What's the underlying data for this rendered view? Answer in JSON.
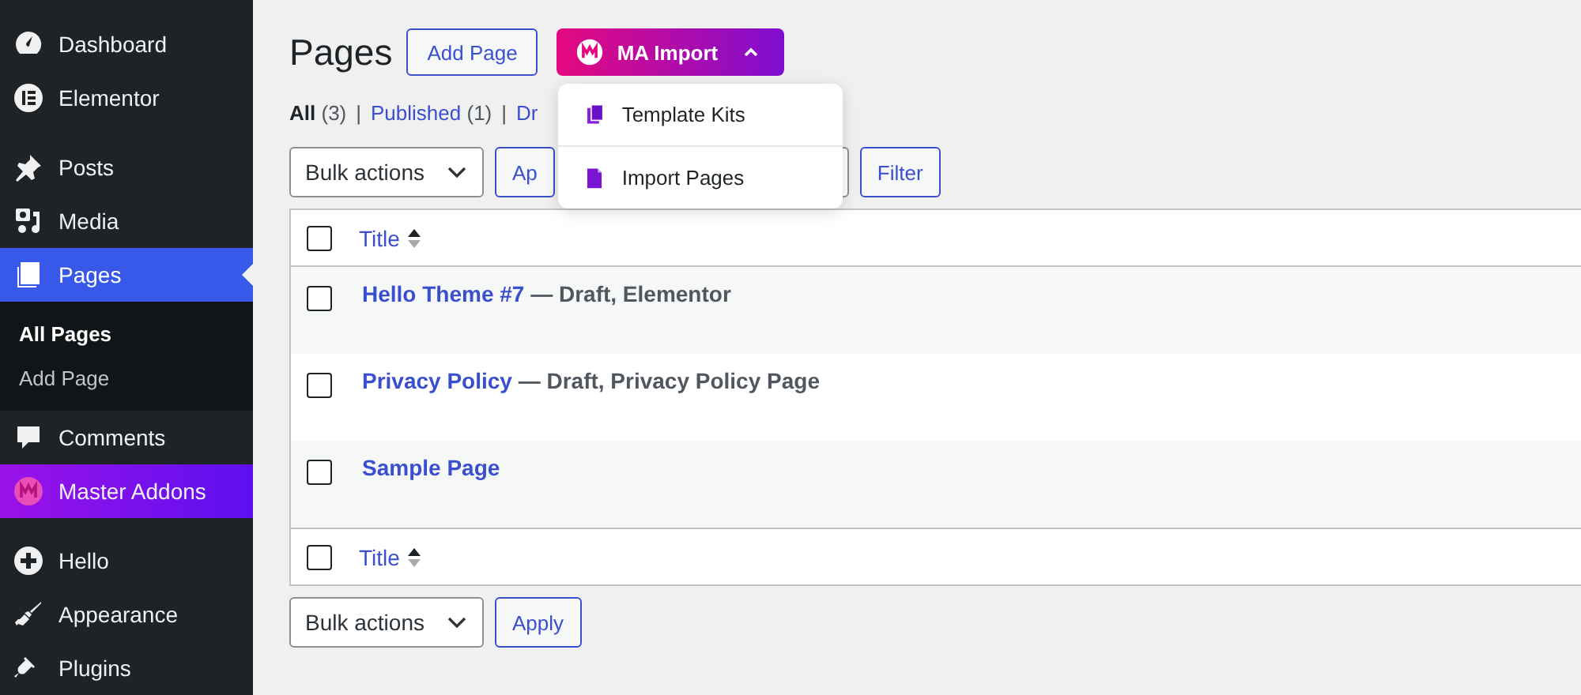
{
  "sidebar": {
    "groups": [
      [
        {
          "label": "Dashboard",
          "kind": "item",
          "selected": false
        },
        {
          "label": "Elementor",
          "kind": "item",
          "selected": false
        }
      ],
      [
        {
          "label": "Posts",
          "kind": "item",
          "selected": false
        },
        {
          "label": "Media",
          "kind": "item",
          "selected": false
        },
        {
          "label": "Pages",
          "kind": "item",
          "selected": true,
          "children": [
            {
              "label": "All Pages",
              "selected": true
            },
            {
              "label": "Add Page",
              "selected": false
            }
          ]
        },
        {
          "label": "Comments",
          "kind": "item",
          "selected": false
        },
        {
          "label": "Master Addons",
          "kind": "plugin",
          "selected": false
        }
      ],
      [
        {
          "label": "Hello",
          "kind": "item",
          "selected": false
        },
        {
          "label": "Appearance",
          "kind": "item",
          "selected": false
        },
        {
          "label": "Plugins",
          "kind": "item",
          "selected": false
        }
      ]
    ]
  },
  "header": {
    "title": "Pages",
    "add_button": "Add Page",
    "import_button": {
      "label": "MA Import",
      "expanded": true,
      "menu": [
        "Template Kits",
        "Import Pages"
      ]
    }
  },
  "views": [
    {
      "label": "All",
      "count": "(3)",
      "selected": true
    },
    {
      "separator": "|",
      "label": "Published",
      "count": "(1)",
      "selected": false
    },
    {
      "separator": "|",
      "label": "Dr",
      "selected": false
    }
  ],
  "top_actions": {
    "bulk": "Bulk actions",
    "apply": "Ap",
    "filter": "Filter"
  },
  "table": {
    "header_column": "Title",
    "footer_column": "Title",
    "header_checked": false,
    "footer_checked": false,
    "rows": [
      {
        "title": "Hello Theme #7",
        "state": "— Draft, Elementor",
        "checked": false
      },
      {
        "title": "Privacy Policy",
        "state": "— Draft, Privacy Policy Page",
        "checked": false
      },
      {
        "title": "Sample Page",
        "checked": false
      }
    ]
  },
  "bottom_actions": {
    "bulk": "Bulk actions",
    "apply": "Apply"
  }
}
